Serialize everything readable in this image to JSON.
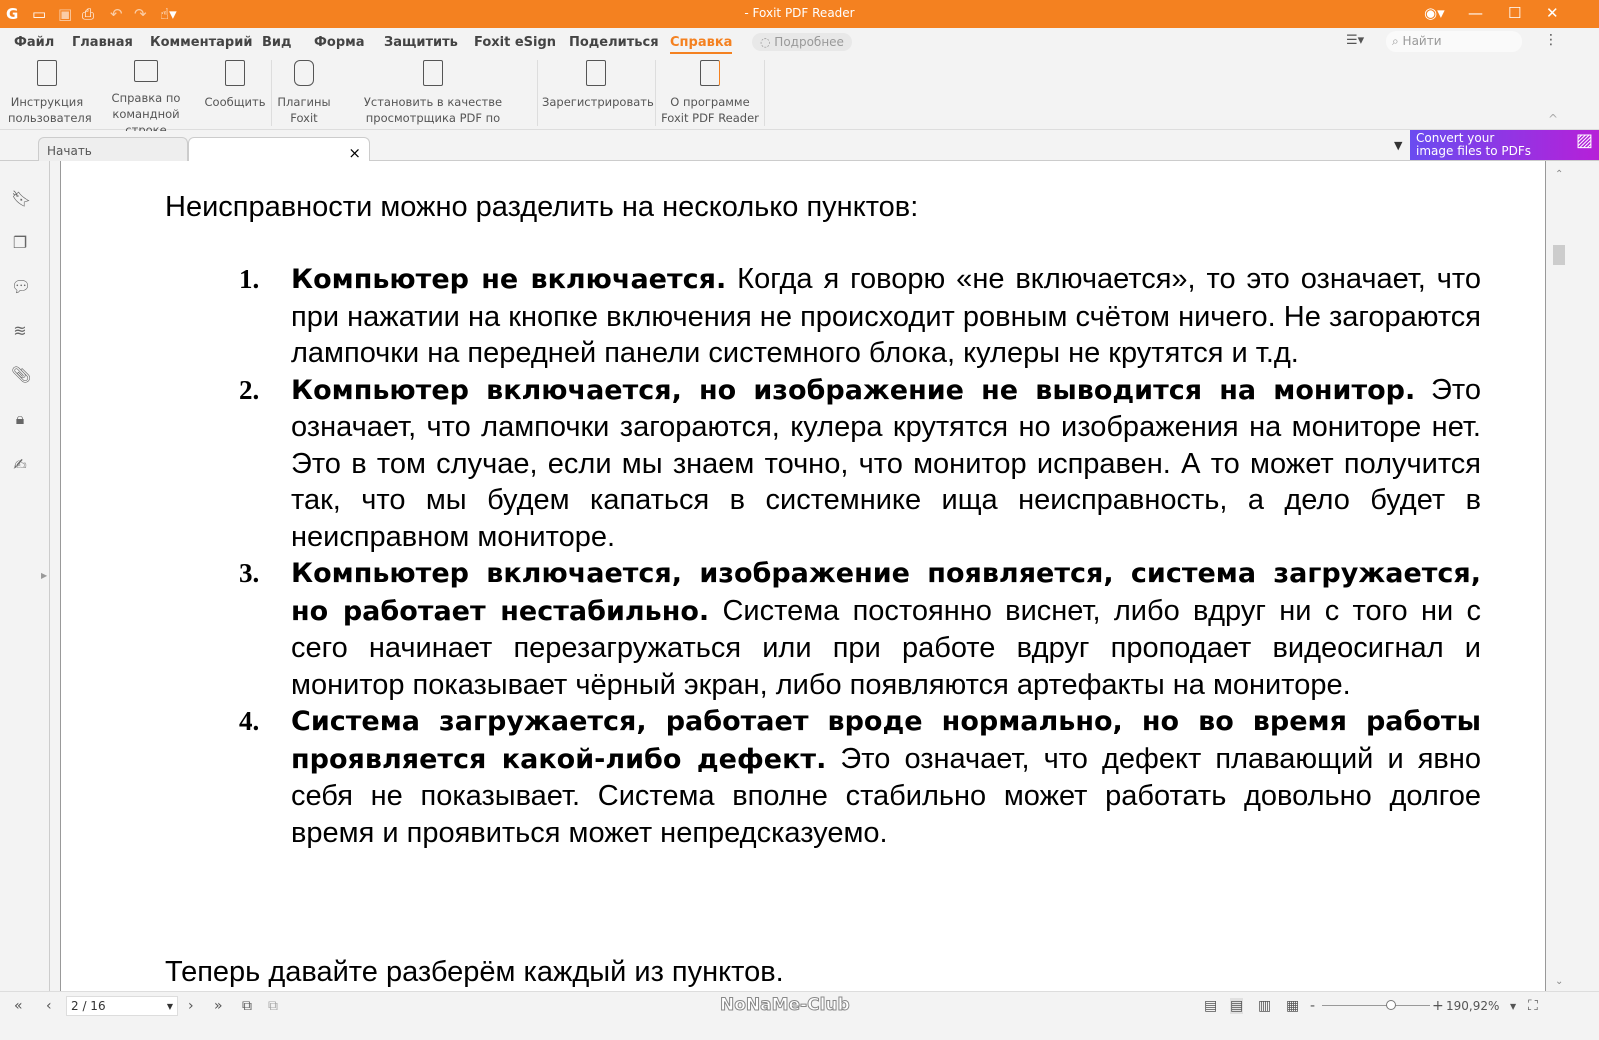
{
  "app": {
    "title": "- Foxit PDF Reader"
  },
  "menu": [
    "Файл",
    "Главная",
    "Комментарий",
    "Вид",
    "Форма",
    "Защитить",
    "Foxit eSign",
    "Поделиться",
    "Справка"
  ],
  "tell_me": "Подробнее",
  "search": {
    "placeholder": "Найти"
  },
  "ribbon": [
    {
      "l1": "Инструкция",
      "l2": "пользователя"
    },
    {
      "l1": "Справка по",
      "l2": "командной строке"
    },
    {
      "l1": "Сообщить",
      "l2": ""
    },
    {
      "l1": "Плагины",
      "l2": "Foxit"
    },
    {
      "l1": "Установить в качестве",
      "l2": "просмотрщика PDF по умолчанию"
    },
    {
      "l1": "Зарегистрировать",
      "l2": ""
    },
    {
      "l1": "О программе",
      "l2": "Foxit PDF Reader"
    }
  ],
  "tabs": {
    "start": "Начать",
    "close": "×"
  },
  "promo": {
    "l1": "Convert your",
    "l2": "image files to PDFs"
  },
  "doc": {
    "intro": "Неисправности можно разделить на несколько пунктов:",
    "items": [
      {
        "num": "1.",
        "bold": "Компьютер не включается.",
        "text": " Когда я говорю «не включается», то это означает, что при нажатии на кнопке включения не происходит ровным счётом ничего. Не загораются лампочки на передней панели системного блока, кулеры не крутятся и т.д."
      },
      {
        "num": "2.",
        "bold": "Компьютер включается, но изображение не выводится на монитор.",
        "text": " Это означает, что лампочки загораются, кулера крутятся но изображения на мониторе нет. Это в том случае, если мы знаем точно, что монитор исправен. А то может получится так, что мы будем капаться в системнике ища неисправность, а дело будет в неисправном мониторе."
      },
      {
        "num": "3.",
        "bold": "Компьютер включается, изображение появляется, система загружается, но работает нестабильно.",
        "text": " Система постоянно виснет, либо вдруг ни с того ни с сего начинает перезагружаться или при работе вдруг проподает видеосигнал и монитор показывает чёрный экран, либо появляются артефакты на мониторе."
      },
      {
        "num": "4.",
        "bold": "Система загружается, работает вроде нормально, но во время работы проявляется какой-либо дефект.",
        "text": " Это означает, что дефект плавающий и явно себя не показывает. Система вполне стабильно может работать довольно долгое время и проявиться может непредсказуемо."
      }
    ],
    "outro": "Теперь давайте разберём каждый из пунктов."
  },
  "status": {
    "page": "2 / 16",
    "zoom": "190,92%",
    "watermark": "NoNaMe-Club"
  }
}
